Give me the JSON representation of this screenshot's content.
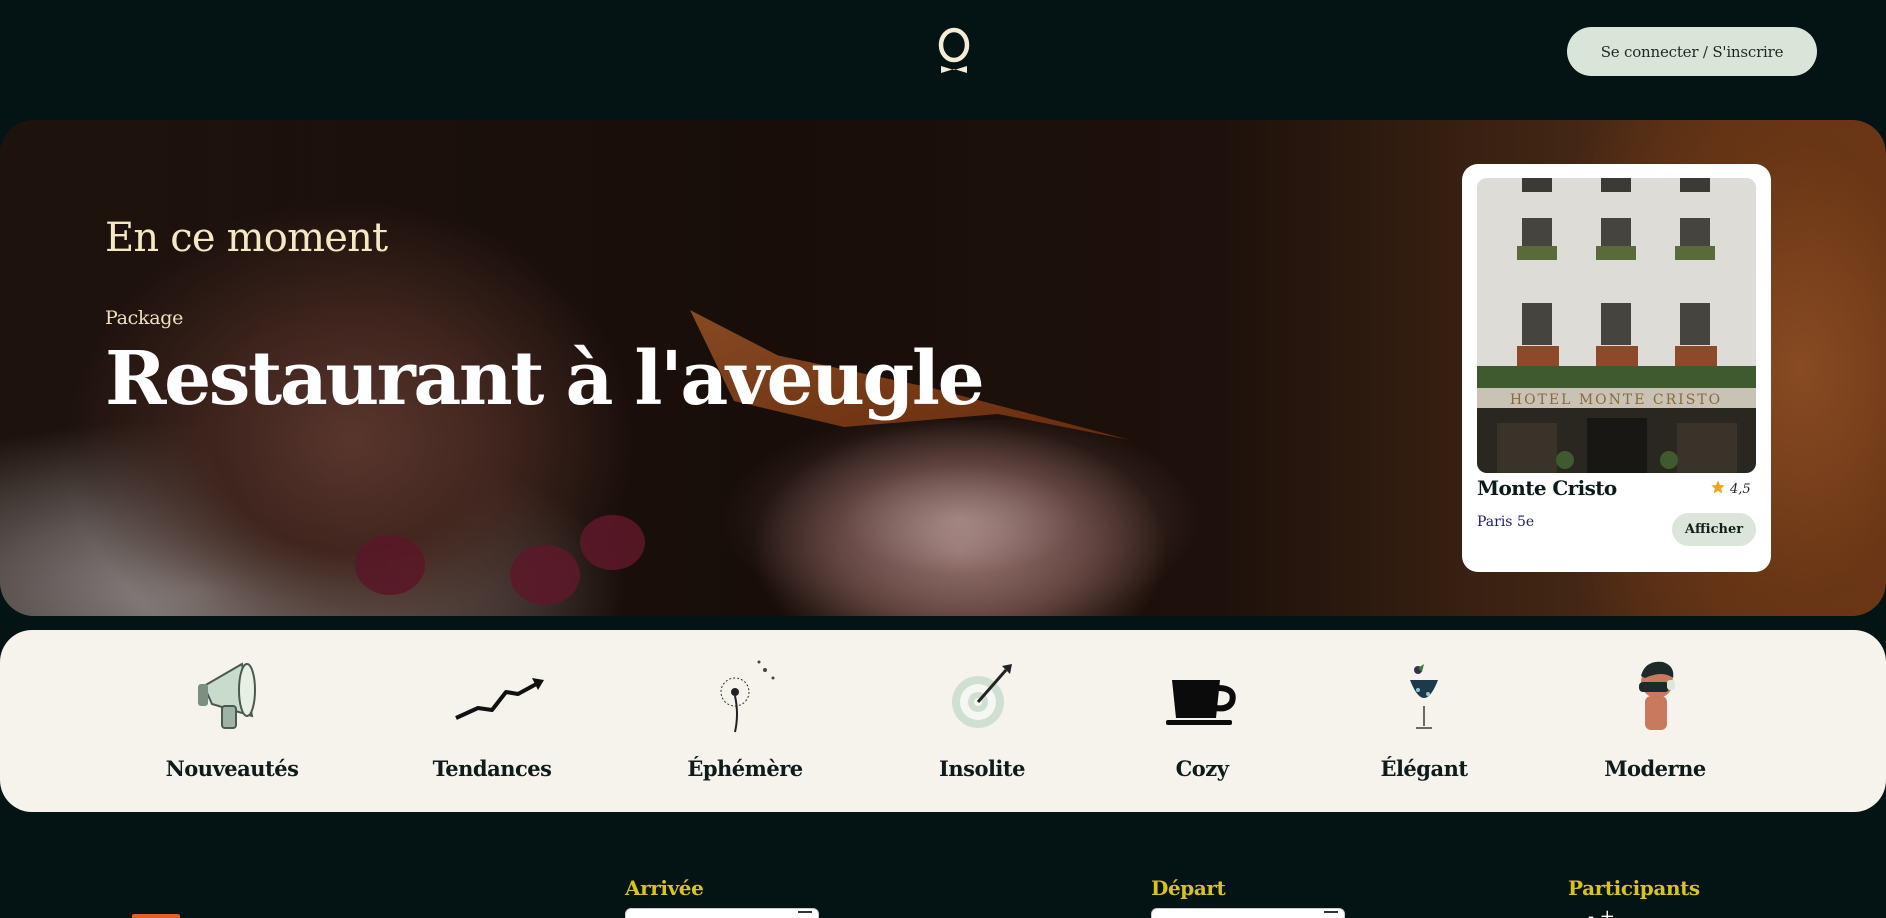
{
  "header": {
    "logo_alt": "O",
    "login_label": "Se connecter / S'inscrire"
  },
  "hero": {
    "eyebrow": "En ce moment",
    "tag": "Package",
    "title": "Restaurant à l'aveugle",
    "carousel": {
      "count": 4,
      "active_index": 0,
      "active_color": "#d8c21f"
    }
  },
  "hotel_card": {
    "name": "Monte Cristo",
    "rating": "4,5",
    "city": "Paris 5e",
    "button_label": "Afficher",
    "facade_sign": "HOTEL MONTE CRISTO"
  },
  "categories": [
    {
      "label": "Nouveautés",
      "icon": "megaphone-icon"
    },
    {
      "label": "Tendances",
      "icon": "trend-arrow-icon"
    },
    {
      "label": "Éphémère",
      "icon": "dandelion-icon"
    },
    {
      "label": "Insolite",
      "icon": "target-icon"
    },
    {
      "label": "Cozy",
      "icon": "coffee-cup-icon"
    },
    {
      "label": "Élégant",
      "icon": "cocktail-icon"
    },
    {
      "label": "Moderne",
      "icon": "modern-person-icon"
    }
  ],
  "search": {
    "arrival_label": "Arrivée",
    "departure_label": "Départ",
    "participants_label": "Participants",
    "stepper": "- +"
  },
  "colors": {
    "background": "#041313",
    "accent_yellow": "#d8c21f",
    "button_green": "#d9e5d9",
    "category_bg": "#f6f2ec"
  }
}
